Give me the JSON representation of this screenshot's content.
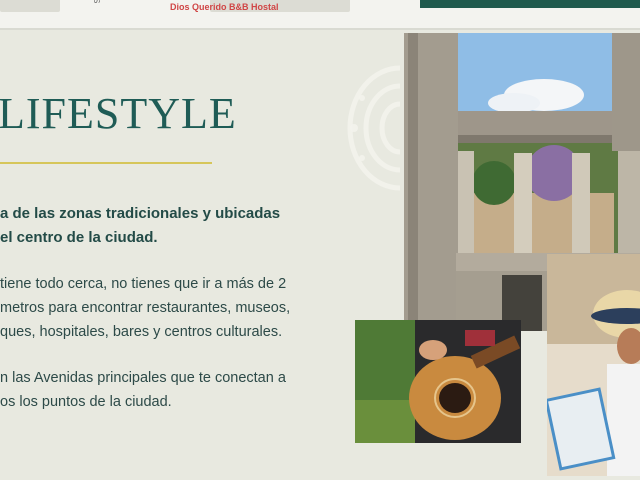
{
  "browser": {
    "map_label": "Dios Querido B&B Hostal"
  },
  "slide": {
    "title": "LIFESTYLE",
    "lines": [
      "a de las zonas tradicionales y ubicadas",
      "el centro de la ciudad.",
      "tiene todo cerca, no tienes que ir a más de 2",
      "metros para encontrar restaurantes, museos,",
      "ques, hospitales, bares y centros culturales.",
      "n las Avenidas principales que te conectan a",
      "os los puntos de la ciudad."
    ]
  },
  "colors": {
    "background": "#e8e9e0",
    "title": "#1f5c56",
    "rule": "#d6c65a",
    "header_green": "#1f5a4d"
  }
}
